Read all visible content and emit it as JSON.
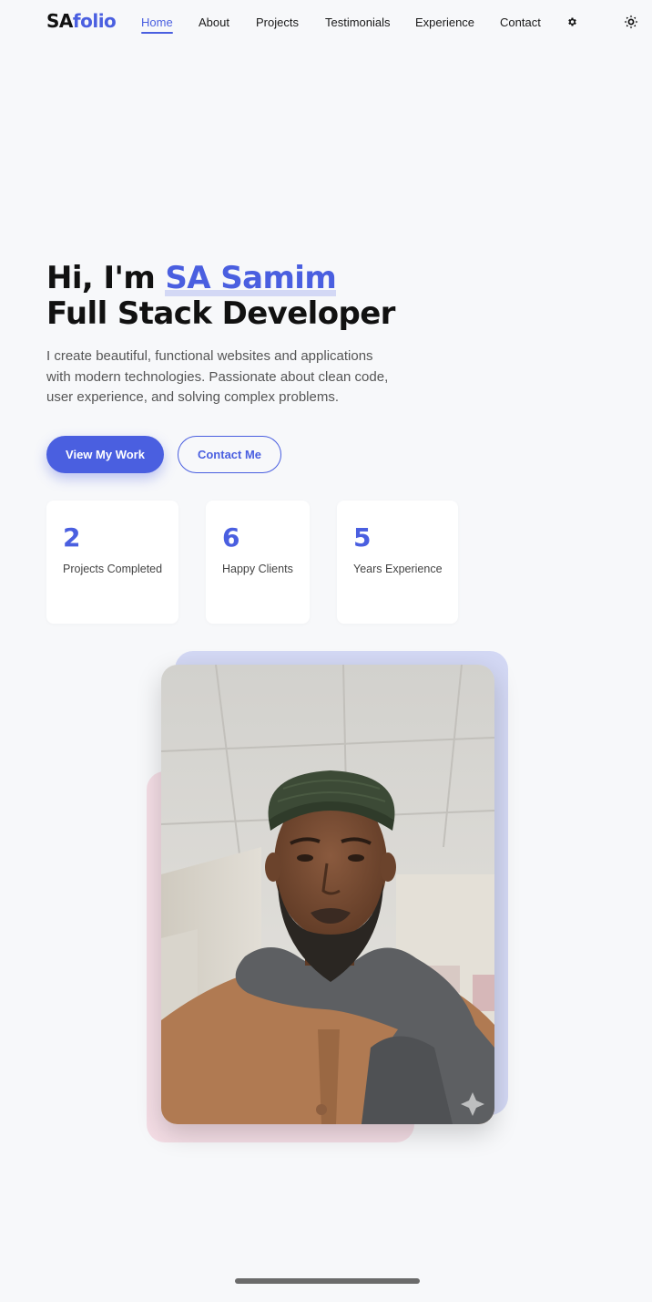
{
  "nav": {
    "logo_part1": "SA",
    "logo_part2": "folio",
    "links": [
      "Home",
      "About",
      "Projects",
      "Testimonials",
      "Experience",
      "Contact"
    ],
    "active_link": "Home",
    "settings_icon": "gear-icon",
    "theme_icon": "sun-icon"
  },
  "hero": {
    "greeting": "Hi, I'm",
    "name": "SA Samim",
    "role": "Full Stack Developer",
    "description": "I create beautiful, functional websites and applications with modern technologies. Passionate about clean code, user experience, and solving complex problems.",
    "primary_button": "View My Work",
    "secondary_button": "Contact Me"
  },
  "stats": [
    {
      "value": "2",
      "label": "Projects Completed"
    },
    {
      "value": "6",
      "label": "Happy Clients"
    },
    {
      "value": "5",
      "label": "Years Experience"
    }
  ],
  "colors": {
    "accent": "#4a5fe0",
    "background": "#f7f8fa",
    "blob_blue": "#d3d8f4",
    "blob_pink": "#f4dde5"
  }
}
